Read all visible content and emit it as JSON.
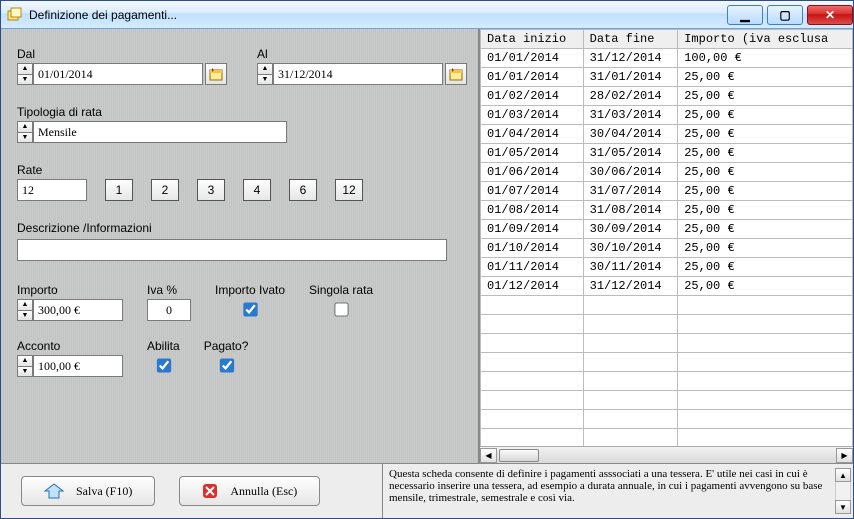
{
  "window": {
    "title": "Definizione dei pagamenti..."
  },
  "controls": {
    "min": "_",
    "max": "☐",
    "close": "✕"
  },
  "dates": {
    "dal_label": "Dal",
    "dal_value": "01/01/2014",
    "al_label": "Al",
    "al_value": "31/12/2014"
  },
  "tipologia": {
    "label": "Tipologia di rata",
    "value": "Mensile"
  },
  "rate": {
    "label": "Rate",
    "value": "12",
    "presets": [
      "1",
      "2",
      "3",
      "4",
      "6",
      "12"
    ]
  },
  "descrizione": {
    "label": "Descrizione /Informazioni",
    "value": ""
  },
  "importo": {
    "label": "Importo",
    "value": "300,00 €"
  },
  "iva": {
    "label": "Iva %",
    "value": "0"
  },
  "importo_ivato": {
    "label": "Importo Ivato",
    "checked": true
  },
  "singola_rata": {
    "label": "Singola rata",
    "checked": false
  },
  "acconto": {
    "label": "Acconto",
    "value": "100,00 €"
  },
  "abilita": {
    "label": "Abilita",
    "checked": true
  },
  "pagato": {
    "label": "Pagato?",
    "checked": true
  },
  "table": {
    "headers": [
      "Data inizio",
      "Data fine",
      "Importo (iva esclusa"
    ],
    "rows": [
      [
        "01/01/2014",
        "31/12/2014",
        "100,00 €"
      ],
      [
        "01/01/2014",
        "31/01/2014",
        "25,00 €"
      ],
      [
        "01/02/2014",
        "28/02/2014",
        "25,00 €"
      ],
      [
        "01/03/2014",
        "31/03/2014",
        "25,00 €"
      ],
      [
        "01/04/2014",
        "30/04/2014",
        "25,00 €"
      ],
      [
        "01/05/2014",
        "31/05/2014",
        "25,00 €"
      ],
      [
        "01/06/2014",
        "30/06/2014",
        "25,00 €"
      ],
      [
        "01/07/2014",
        "31/07/2014",
        "25,00 €"
      ],
      [
        "01/08/2014",
        "31/08/2014",
        "25,00 €"
      ],
      [
        "01/09/2014",
        "30/09/2014",
        "25,00 €"
      ],
      [
        "01/10/2014",
        "30/10/2014",
        "25,00 €"
      ],
      [
        "01/11/2014",
        "30/11/2014",
        "25,00 €"
      ],
      [
        "01/12/2014",
        "31/12/2014",
        "25,00 €"
      ]
    ],
    "empty_rows": 9
  },
  "buttons": {
    "save": "Salva  (F10)",
    "cancel": "Annulla  (Esc)"
  },
  "help": {
    "text": "Questa scheda consente di definire i pagamenti asssociati a una tessera. E' utile nei casi in cui è necessario inserire una tessera, ad esempio a durata annuale, in cui i pagamenti avvengono su base mensile, trimestrale, semestrale e così via."
  }
}
